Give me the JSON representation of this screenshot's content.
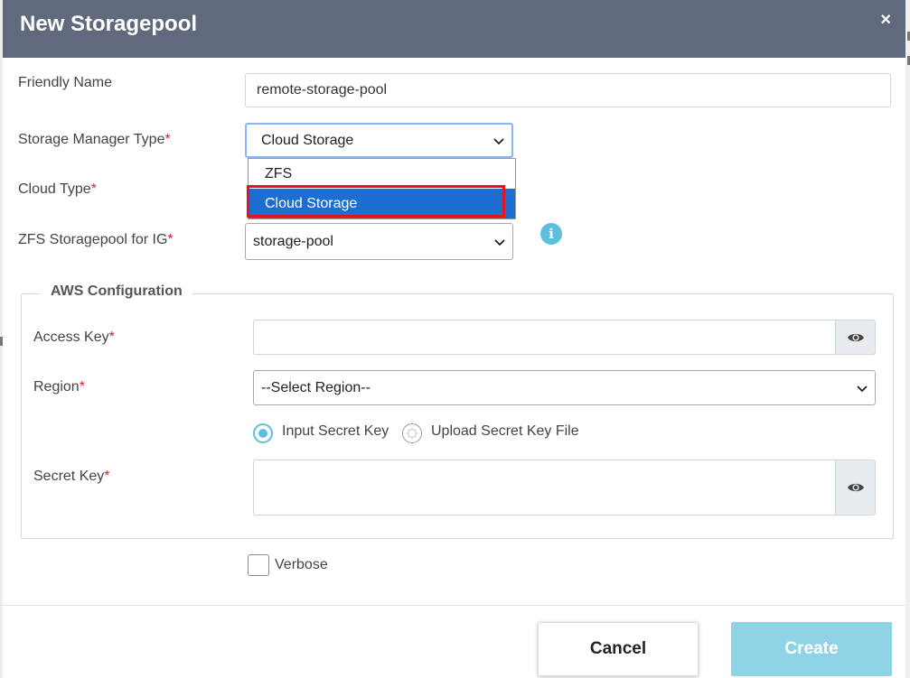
{
  "modal": {
    "title": "New Storagepool",
    "close_icon": "×"
  },
  "form": {
    "friendly_name": {
      "label": "Friendly Name",
      "value": "remote-storage-pool"
    },
    "storage_manager_type": {
      "label": "Storage Manager Type",
      "required_mark": "*",
      "selected": "Cloud Storage",
      "options": [
        "ZFS",
        "Cloud Storage"
      ],
      "highlighted_option": "Cloud Storage"
    },
    "cloud_type": {
      "label": "Cloud Type",
      "required_mark": "*"
    },
    "zfs_storagepool": {
      "label": "ZFS Storagepool for IG",
      "required_mark": "*",
      "selected": "storage-pool"
    },
    "verbose": {
      "label": "Verbose",
      "checked": false
    }
  },
  "aws": {
    "legend": "AWS Configuration",
    "access_key": {
      "label": "Access Key",
      "required_mark": "*",
      "value": ""
    },
    "region": {
      "label": "Region",
      "required_mark": "*",
      "selected": "--Select Region--"
    },
    "secret_mode": {
      "options": [
        "Input Secret Key",
        "Upload Secret Key File"
      ],
      "selected": "Input Secret Key"
    },
    "secret_key": {
      "label": "Secret Key",
      "required_mark": "*",
      "value": ""
    }
  },
  "footer": {
    "cancel_label": "Cancel",
    "create_label": "Create"
  },
  "colors": {
    "header_bg": "#616a7c",
    "accent": "#5bc0de",
    "selected_option_bg": "#1d6ed1",
    "highlight_border": "#e0142a",
    "required": "#d9232e",
    "create_button_bg": "#8fd3e6"
  },
  "icons": {
    "close": "close-icon",
    "info": "info-icon",
    "eye": "eye-icon",
    "chevron": "chevron-down-icon"
  }
}
